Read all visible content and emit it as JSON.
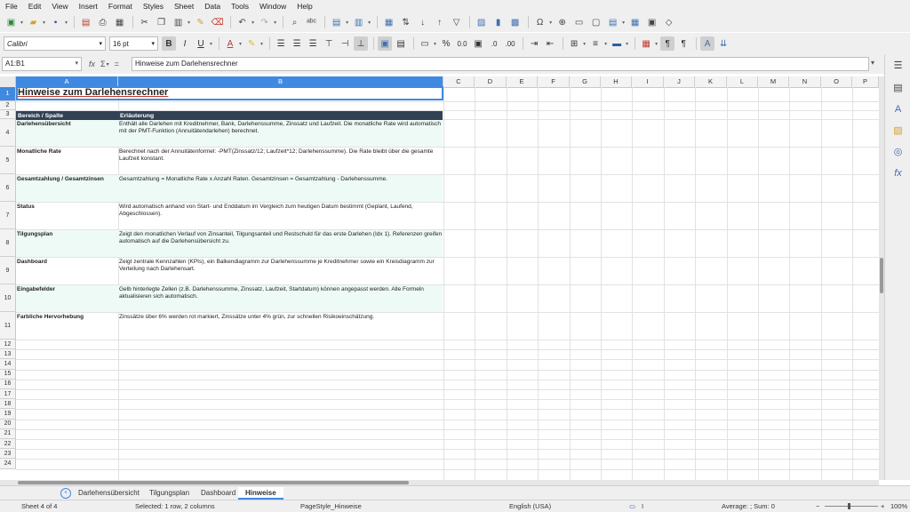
{
  "menu": [
    "File",
    "Edit",
    "View",
    "Insert",
    "Format",
    "Styles",
    "Sheet",
    "Data",
    "Tools",
    "Window",
    "Help"
  ],
  "toolbar": {
    "font_name": "Calibri",
    "font_size": "16 pt"
  },
  "formula_bar": {
    "name_box": "A1:B1",
    "content": "Hinweise zum Darlehensrechner"
  },
  "columns": [
    "A",
    "B",
    "C",
    "D",
    "E",
    "F",
    "G",
    "H",
    "I",
    "J",
    "K",
    "L",
    "M",
    "N",
    "O",
    "P"
  ],
  "rows": [
    "1",
    "2",
    "3",
    "4",
    "5",
    "6",
    "7",
    "8",
    "9",
    "10",
    "11",
    "12",
    "13",
    "14",
    "15",
    "16",
    "17",
    "18",
    "19",
    "20",
    "21",
    "22",
    "23",
    "24"
  ],
  "sheet": {
    "title": "Hinweise zum Darlehensrechner",
    "header": {
      "a": "Bereich / Spalte",
      "b": "Erläuterung"
    },
    "entries": [
      {
        "a": "Darlehensübersicht",
        "b": "Enthält alle Darlehen mit Kreditnehmer, Bank, Darlehenssumme, Zinssatz und Laufzeit. Die monatliche Rate wird automatisch mit der PMT-Funktion (Annuitätendarlehen) berechnet."
      },
      {
        "a": "Monatliche Rate",
        "b": "Berechnet nach der Annuitätenformel: -PMT(Zinssatz/12; Laufzeit*12; Darlehenssumme). Die Rate bleibt über die gesamte Laufzeit konstant."
      },
      {
        "a": "Gesamtzahlung / Gesamtzinsen",
        "b": "Gesamtzahlung = Monatliche Rate x Anzahl Raten. Gesamtzinsen = Gesamtzahlung - Darlehenssumme."
      },
      {
        "a": "Status",
        "b": "Wird automatisch anhand von Start- und Enddatum im Vergleich zum heutigen Datum bestimmt (Geplant, Laufend, Abgeschlossen)."
      },
      {
        "a": "Tilgungsplan",
        "b": "Zeigt den monatlichen Verlauf von Zinsanteil, Tilgungsanteil und Restschuld für das erste Darlehen (Idx 1). Referenzen greifen automatisch auf die Darlehensübersicht zu."
      },
      {
        "a": "Dashboard",
        "b": "Zeigt zentrale Kennzahlen (KPIs), ein Balkendiagramm zur Darlehenssumme je Kreditnehmer sowie ein Kreisdiagramm zur Verteilung nach Darlehensart."
      },
      {
        "a": "Eingabefelder",
        "b": "Gelb hinterlegte Zellen (z.B. Darlehenssumme, Zinssatz, Laufzeit, Startdatum) können angepasst werden. Alle Formeln aktualisieren sich automatisch."
      },
      {
        "a": "Farbliche Hervorhebung",
        "b": "Zinssätze über 6% werden rot markiert, Zinssätze unter 4% grün, zur schnellen Risikoeinschätzung."
      }
    ]
  },
  "tabs": [
    "Darlehensübersicht",
    "Tilgungsplan",
    "Dashboard",
    "Hinweise"
  ],
  "active_tab": "Hinweise",
  "status": {
    "sheet": "Sheet 4 of 4",
    "selection": "Selected: 1 row, 2 columns",
    "page_style": "PageStyle_Hinweise",
    "language": "English (USA)",
    "summary": "Average: ; Sum: 0",
    "zoom": "100%"
  },
  "colors": {
    "accent": "#3f8ae0",
    "header_fill": "#334155",
    "band_fill": "#eefaf6"
  }
}
